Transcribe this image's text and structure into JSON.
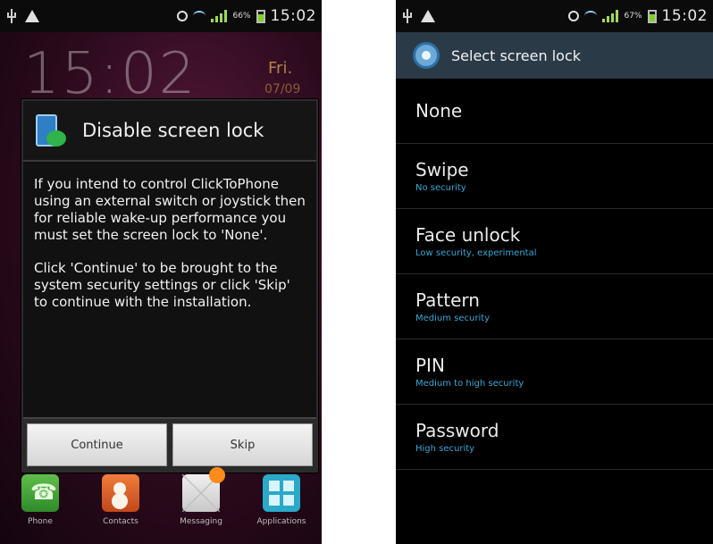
{
  "left_phone": {
    "status_bar": {
      "battery_pct": "66%",
      "time": "15:02"
    },
    "lockscreen": {
      "clock": "15:02",
      "day": "Fri.",
      "date": "07/09"
    },
    "dialog": {
      "title": "Disable screen lock",
      "paragraph1": "If you intend to control ClickToPhone using an external switch or joystick then for reliable wake-up performance you must set the screen lock to 'None'.",
      "paragraph2": "Click 'Continue' to be brought to the system security settings or click 'Skip' to continue with the installation.",
      "continue_label": "Continue",
      "skip_label": "Skip"
    },
    "dock": [
      {
        "label": "Phone"
      },
      {
        "label": "Contacts"
      },
      {
        "label": "Messaging"
      },
      {
        "label": "Applications"
      }
    ]
  },
  "right_phone": {
    "status_bar": {
      "battery_pct": "67%",
      "time": "15:02"
    },
    "header": {
      "title": "Select screen lock"
    },
    "options": [
      {
        "label": "None",
        "subtitle": ""
      },
      {
        "label": "Swipe",
        "subtitle": "No security"
      },
      {
        "label": "Face unlock",
        "subtitle": "Low security, experimental"
      },
      {
        "label": "Pattern",
        "subtitle": "Medium security"
      },
      {
        "label": "PIN",
        "subtitle": "Medium to high security"
      },
      {
        "label": "Password",
        "subtitle": "High security"
      }
    ]
  }
}
